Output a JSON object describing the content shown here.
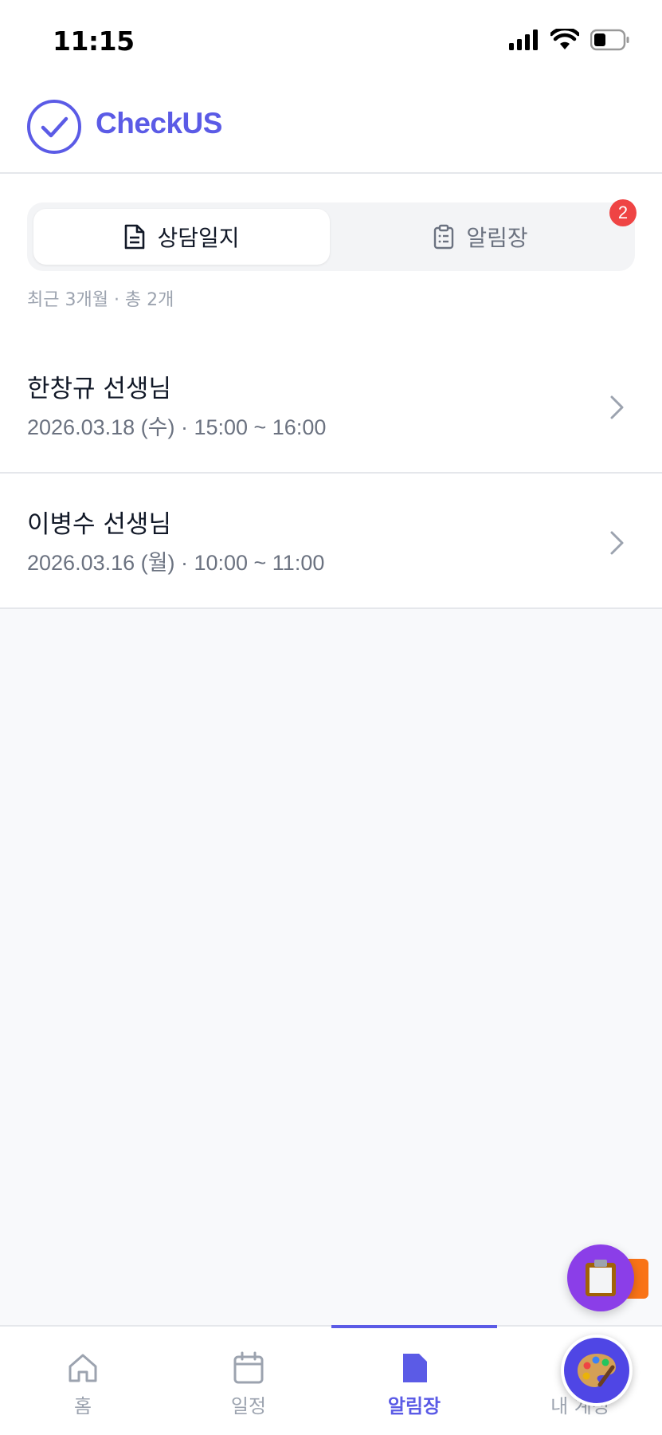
{
  "status_bar": {
    "time": "11:15"
  },
  "header": {
    "app_name": "CheckUS",
    "brand_color": "#5b5be6"
  },
  "tabs": [
    {
      "label": "상담일지",
      "icon": "document-icon",
      "active": true
    },
    {
      "label": "알림장",
      "icon": "clipboard-icon",
      "active": false,
      "badge": "2"
    }
  ],
  "summary": "최근 3개월 · 총 2개",
  "consultations": [
    {
      "teacher": "한창규 선생님",
      "datetime": "2026.03.18 (수) · 15:00 ~ 16:00"
    },
    {
      "teacher": "이병수 선생님",
      "datetime": "2026.03.16 (월) · 10:00 ~ 11:00"
    }
  ],
  "bottom_nav": [
    {
      "label": "홈",
      "icon": "home-icon"
    },
    {
      "label": "일정",
      "icon": "calendar-icon"
    },
    {
      "label": "알림장",
      "icon": "note-icon",
      "active": true
    },
    {
      "label": "내 계정",
      "icon": "user-icon"
    }
  ],
  "colors": {
    "badge": "#ef4444",
    "fab_purple": "#8b3ee8",
    "fab_indigo": "#4f46e5",
    "orange": "#f97316"
  }
}
